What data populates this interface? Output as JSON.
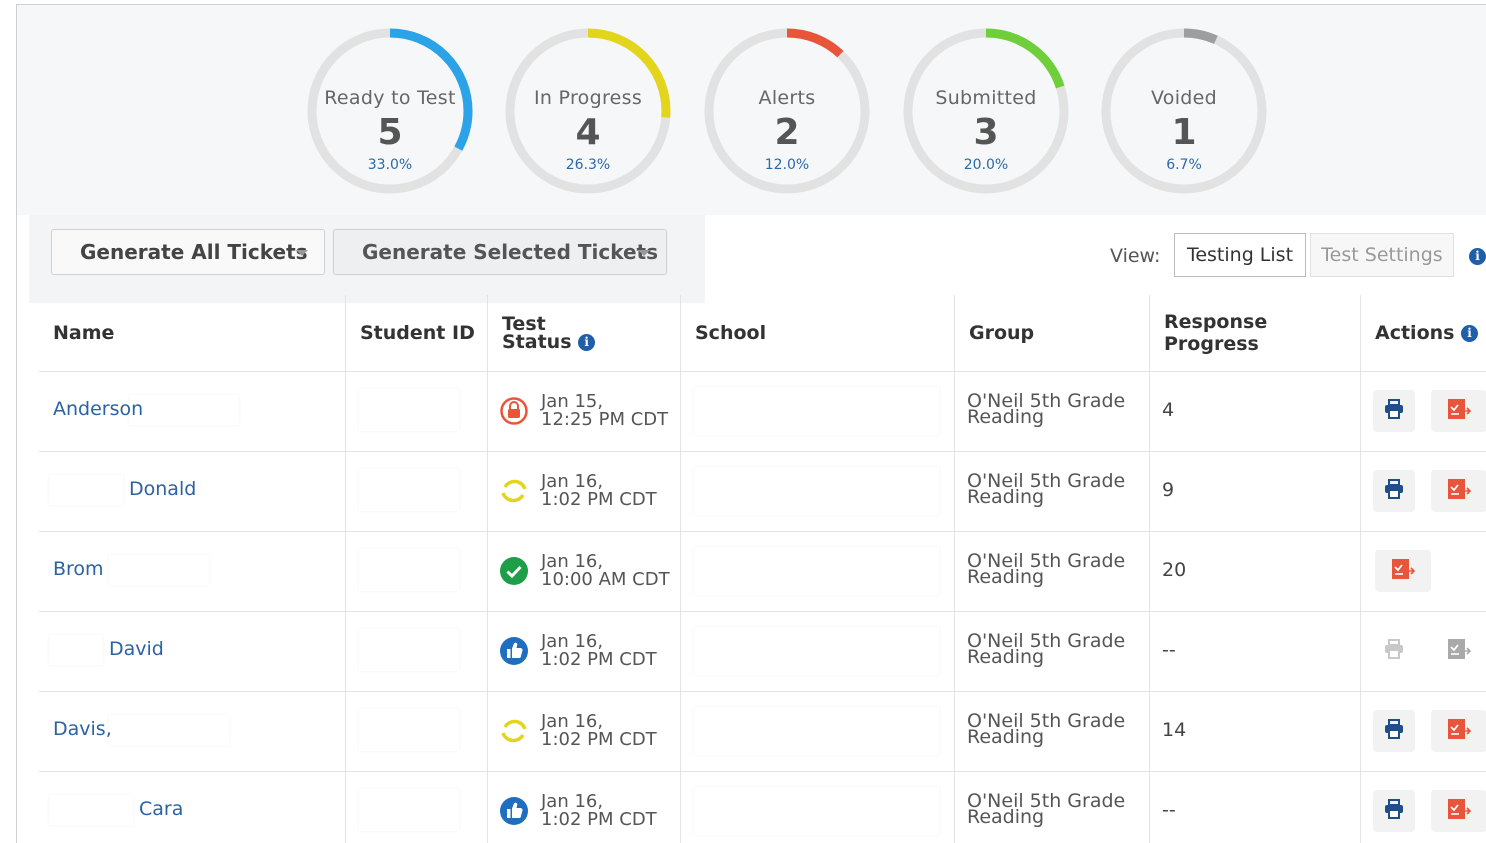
{
  "summary": [
    {
      "label": "Ready to Test",
      "count": "5",
      "percent": "33.0%",
      "fraction": 0.33,
      "color": "#2aa3e8"
    },
    {
      "label": "In Progress",
      "count": "4",
      "percent": "26.3%",
      "fraction": 0.263,
      "color": "#e3d51b"
    },
    {
      "label": "Alerts",
      "count": "2",
      "percent": "12.0%",
      "fraction": 0.12,
      "color": "#e8553a"
    },
    {
      "label": "Submitted",
      "count": "3",
      "percent": "20.0%",
      "fraction": 0.2,
      "color": "#6fcf3a"
    },
    {
      "label": "Voided",
      "count": "1",
      "percent": "6.7%",
      "fraction": 0.067,
      "color": "#9e9e9e"
    }
  ],
  "toolbar": {
    "generate_all": "Generate All Tickets",
    "generate_selected": "Generate Selected Tickets",
    "view_label": "View:",
    "view_testing_list": "Testing List",
    "view_test_settings": "Test Settings"
  },
  "table": {
    "headers": {
      "name": "Name",
      "student_id": "Student ID",
      "test_status_1": "Test",
      "test_status_2": "Status",
      "school": "School",
      "group": "Group",
      "response_progress": "Response Progress",
      "actions": "Actions"
    },
    "rows": [
      {
        "name": "Anderson",
        "status": "alert",
        "date1": "Jan 15,",
        "date2": "12:25 PM CDT",
        "group1": "O'Neil 5th Grade",
        "group2": "Reading",
        "progress": "4",
        "print": true,
        "report": true
      },
      {
        "name": "Donald",
        "status": "in-progress",
        "date1": "Jan 16,",
        "date2": "1:02 PM CDT",
        "group1": "O'Neil 5th Grade",
        "group2": "Reading",
        "progress": "9",
        "print": true,
        "report": true
      },
      {
        "name": "Brom",
        "status": "submitted",
        "date1": "Jan 16,",
        "date2": "10:00 AM CDT",
        "group1": "O'Neil 5th Grade",
        "group2": "Reading",
        "progress": "20",
        "print": false,
        "report": true
      },
      {
        "name": "David",
        "status": "ready",
        "date1": "Jan 16,",
        "date2": "1:02 PM CDT",
        "group1": "O'Neil 5th Grade",
        "group2": "Reading",
        "progress": "--",
        "print": "disabled",
        "report": "disabled"
      },
      {
        "name": "Davis,",
        "status": "in-progress",
        "date1": "Jan 16,",
        "date2": "1:02 PM CDT",
        "group1": "O'Neil 5th Grade",
        "group2": "Reading",
        "progress": "14",
        "print": true,
        "report": true
      },
      {
        "name": "Cara",
        "status": "ready",
        "date1": "Jan 16,",
        "date2": "1:02 PM CDT",
        "group1": "O'Neil 5th Grade",
        "group2": "Reading",
        "progress": "--",
        "print": true,
        "report": true
      }
    ]
  },
  "colors": {
    "link": "#2a62a4",
    "alert": "#e8553a",
    "in_progress": "#e3d51b",
    "submitted": "#1e9e46",
    "ready": "#1e6fc0",
    "report_btn": "#e8553a",
    "print_icon": "#1f4f8a"
  }
}
